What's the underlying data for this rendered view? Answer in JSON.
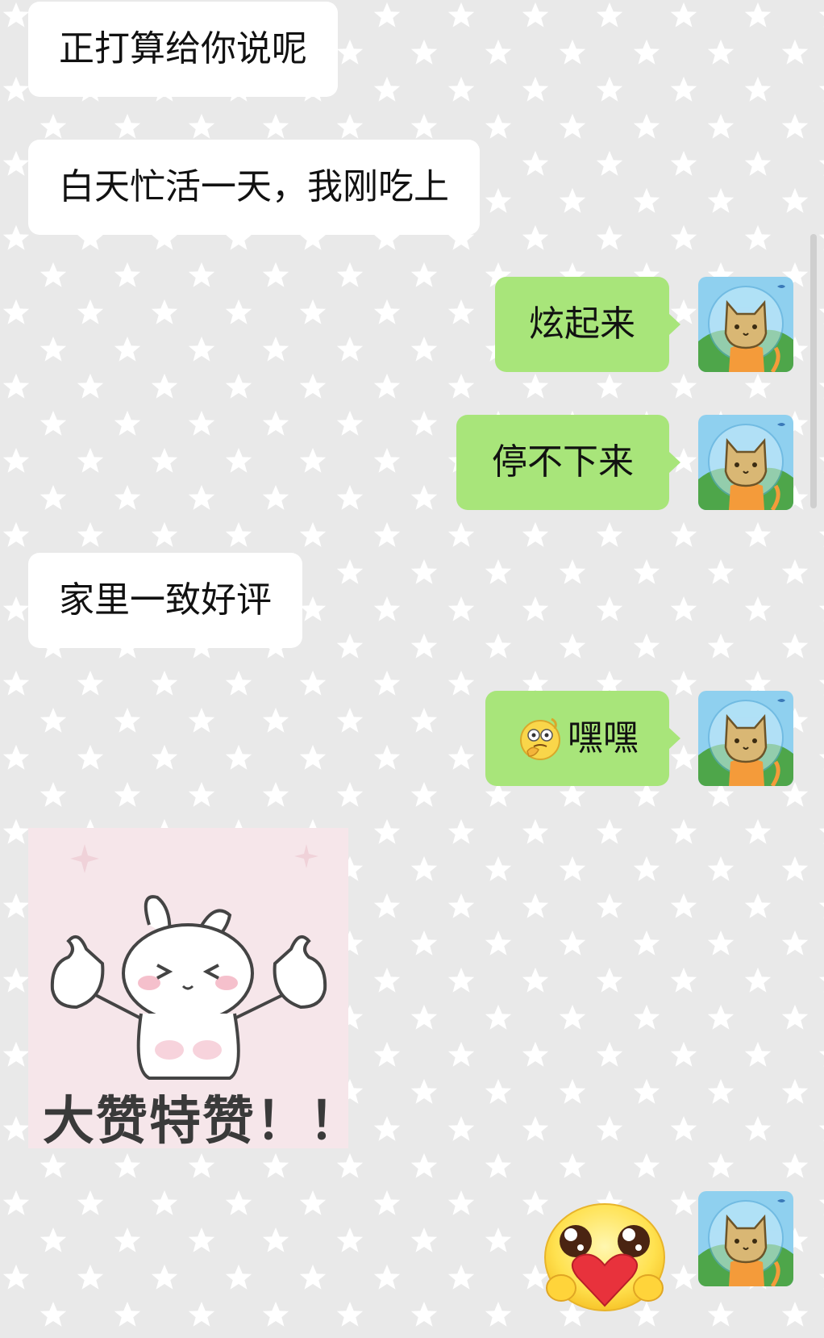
{
  "colors": {
    "background": "#e9e9e9",
    "incoming_bubble": "#ffffff",
    "outgoing_bubble": "#a8e57a",
    "star": "#ffffff"
  },
  "messages": [
    {
      "side": "incoming",
      "type": "text",
      "text": "正打算给你说呢"
    },
    {
      "side": "incoming",
      "type": "text",
      "text": "白天忙活一天，我刚吃上"
    },
    {
      "side": "outgoing",
      "type": "text",
      "text": "炫起来",
      "avatar_icon": "cat-astronaut-avatar-icon"
    },
    {
      "side": "outgoing",
      "type": "text",
      "text": "停不下来",
      "avatar_icon": "cat-astronaut-avatar-icon"
    },
    {
      "side": "incoming",
      "type": "text",
      "text": "家里一致好评"
    },
    {
      "side": "outgoing",
      "type": "text-with-emoji",
      "emoji_icon": "thinking-face-emoji-icon",
      "text": "嘿嘿",
      "avatar_icon": "cat-astronaut-avatar-icon"
    },
    {
      "side": "incoming",
      "type": "sticker",
      "sticker_icon": "bunny-thumbs-up-sticker-icon",
      "caption": "大赞特赞！！"
    },
    {
      "side": "outgoing",
      "type": "emoji",
      "emoji_icon": "heart-hug-emoji-icon",
      "avatar_icon": "cat-astronaut-avatar-icon"
    }
  ]
}
